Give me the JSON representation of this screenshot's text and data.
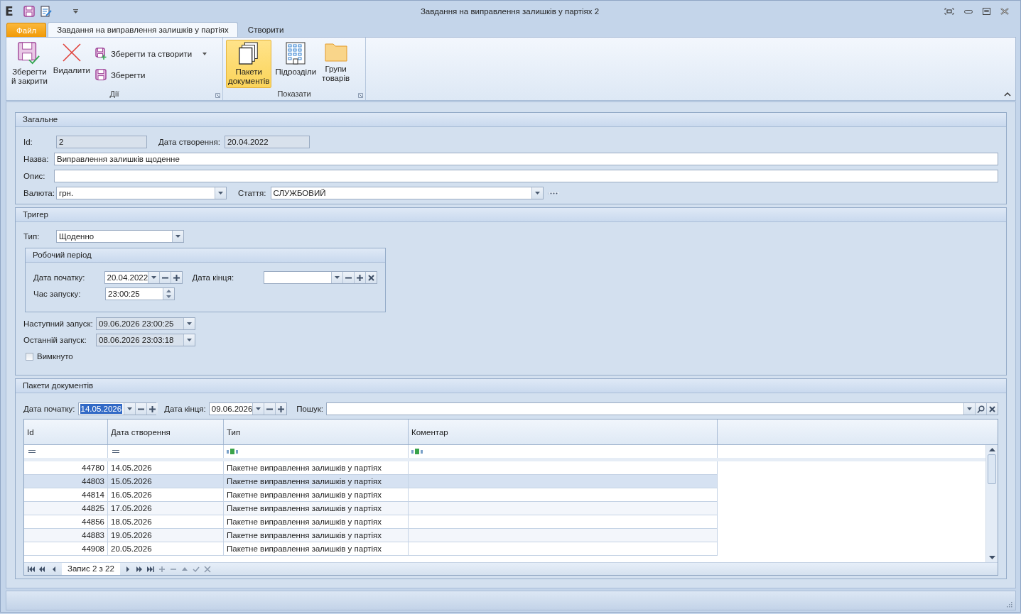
{
  "window": {
    "title": "Завдання на виправлення залишків у партіях 2",
    "app_letter": "E"
  },
  "file_tab": "Файл",
  "tabs": [
    {
      "label": "Завдання на виправлення залишків у партіях",
      "selected": true
    },
    {
      "label": "Створити",
      "selected": false
    }
  ],
  "ribbon": {
    "groups": [
      {
        "label": "Дії",
        "buttons": [
          {
            "label": "Зберегти\nй закрити",
            "kind": "large",
            "selected": false
          },
          {
            "label": "Видалити",
            "kind": "large",
            "selected": false
          },
          {
            "label": "Зберегти та створити",
            "kind": "small",
            "selected": false
          },
          {
            "label": "Зберегти",
            "kind": "small",
            "selected": false
          }
        ]
      },
      {
        "label": "Показати",
        "buttons": [
          {
            "label": "Пакети\nдокументів",
            "kind": "large",
            "selected": true
          },
          {
            "label": "Підрозділи",
            "kind": "large",
            "selected": false
          },
          {
            "label": "Групи\nтоварів",
            "kind": "large",
            "selected": false
          }
        ]
      }
    ]
  },
  "general": {
    "title": "Загальне",
    "id": {
      "label": "Id:",
      "value": "2",
      "disabled": true
    },
    "created": {
      "label": "Дата створення:",
      "value": "20.04.2022",
      "disabled": true
    },
    "name": {
      "label": "Назва:",
      "value": "Виправлення залишків щоденне"
    },
    "description": {
      "label": "Опис:"
    },
    "currency": {
      "label": "Валюта:",
      "value": "грн."
    },
    "article": {
      "label": "Стаття:",
      "value": "СЛУЖБОВИЙ"
    }
  },
  "trigger": {
    "title": "Тригер",
    "type": {
      "label": "Тип:",
      "value": "Щоденно"
    },
    "period": {
      "title": "Робочий період",
      "start": {
        "label": "Дата початку:",
        "value": "20.04.2022"
      },
      "end": {
        "label": "Дата кінця:"
      },
      "time": {
        "label": "Час запуску:",
        "value": "23:00:25"
      }
    },
    "next_run": {
      "label": "Наступний запуск:",
      "value": "09.06.2026 23:00:25",
      "disabled": true
    },
    "last_run": {
      "label": "Останній запуск:",
      "value": "08.06.2026 23:03:18",
      "disabled": true
    },
    "off": {
      "label": "Вимкнуто",
      "checked": false
    }
  },
  "packages": {
    "title": "Пакети документів",
    "start": {
      "label": "Дата початку:",
      "value": "14.05.2026",
      "focused": true
    },
    "end": {
      "label": "Дата кінця:",
      "value": "09.06.2026",
      "focused": false
    },
    "search": {
      "label": "Пошук:"
    },
    "table": {
      "columns": [
        "Id",
        "Дата створення",
        "Тип",
        "Коментар"
      ],
      "rows": [
        {
          "id": "44780",
          "date": "14.05.2026",
          "type": "Пакетне виправлення залишків у партіях",
          "selected": false
        },
        {
          "id": "44803",
          "date": "15.05.2026",
          "type": "Пакетне виправлення залишків у партіях",
          "selected": true
        },
        {
          "id": "44814",
          "date": "16.05.2026",
          "type": "Пакетне виправлення залишків у партіях",
          "selected": false
        },
        {
          "id": "44825",
          "date": "17.05.2026",
          "type": "Пакетне виправлення залишків у партіях",
          "selected": false
        },
        {
          "id": "44856",
          "date": "18.05.2026",
          "type": "Пакетне виправлення залишків у партіях",
          "selected": false
        },
        {
          "id": "44883",
          "date": "19.05.2026",
          "type": "Пакетне виправлення залишків у партіях",
          "selected": false
        },
        {
          "id": "44908",
          "date": "20.05.2026",
          "type": "Пакетне виправлення залишків у партіях",
          "selected": false
        }
      ]
    },
    "navigator": "Запис 2 з 22"
  }
}
